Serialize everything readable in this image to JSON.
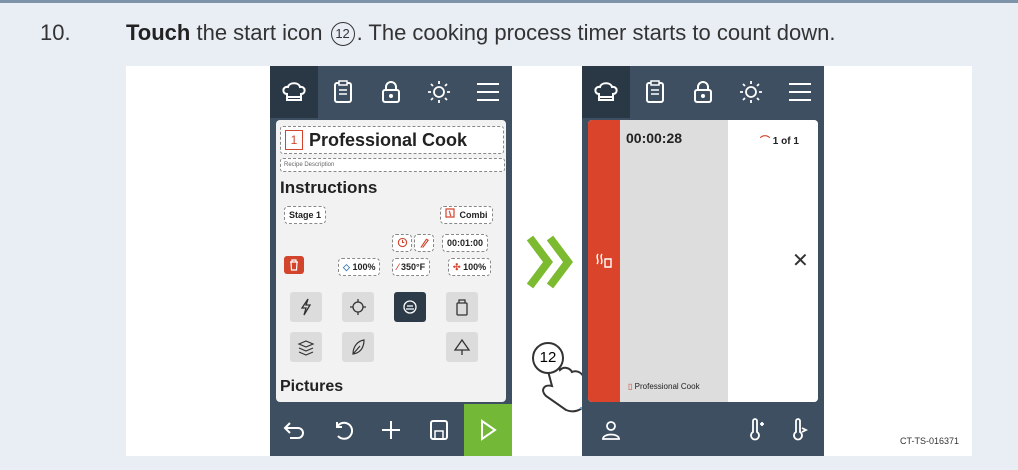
{
  "step": {
    "number": "10.",
    "bold": "Touch",
    "text_before": "the start icon",
    "icon_ref": "12",
    "text_after": ". The cooking process timer starts to count down."
  },
  "screen1": {
    "recipe_number": "1",
    "title": "Professional Cook",
    "description_placeholder": "Recipe Description",
    "instructions_heading": "Instructions",
    "stage_label": "Stage 1",
    "mode_label": "Combi",
    "time_value": "00:01:00",
    "humidity": "100%",
    "temperature": "350°F",
    "fan": "100%",
    "pictures_heading": "Pictures",
    "callout": "12"
  },
  "screen2": {
    "timer": "00:00:28",
    "count": "1 of 1",
    "recipe_label": "Professional Cook"
  },
  "figure_code": "CT-TS-016371",
  "colors": {
    "accent_red": "#d9442b",
    "accent_green": "#73b937",
    "nav_bg": "#3d4f60"
  }
}
